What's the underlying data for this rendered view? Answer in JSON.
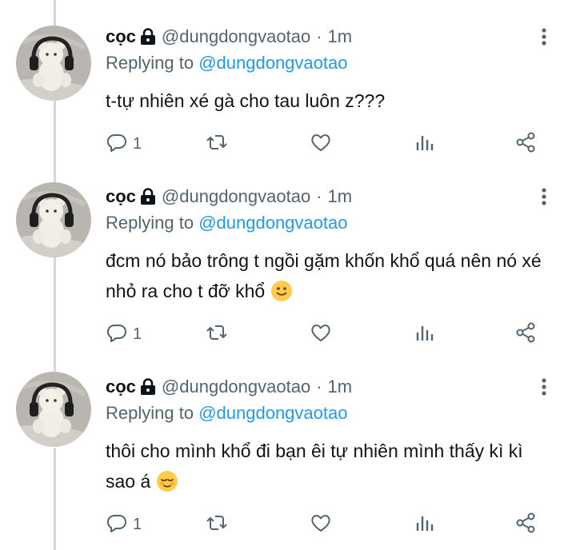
{
  "tweets": [
    {
      "name": "cọc",
      "handle": "@dungdongvaotao",
      "separator": "·",
      "time": "1m",
      "replying_label": "Replying to",
      "replying_handle": "@dungdongvaotao",
      "text": "t-tự nhiên xé gà cho tau luôn z???",
      "emoji": "",
      "reply_count": "1"
    },
    {
      "name": "cọc",
      "handle": "@dungdongvaotao",
      "separator": "·",
      "time": "1m",
      "replying_label": "Replying to",
      "replying_handle": "@dungdongvaotao",
      "text": "đcm nó bảo trông t ngồi gặm khốn khổ quá nên nó xé nhỏ ra cho t đỡ khổ",
      "emoji": "slightly-smiling-face",
      "reply_count": "1"
    },
    {
      "name": "cọc",
      "handle": "@dungdongvaotao",
      "separator": "·",
      "time": "1m",
      "replying_label": "Replying to",
      "replying_handle": "@dungdongvaotao",
      "text": "thôi cho mình khổ đi bạn êi tự nhiên mình thấy kì kì sao á",
      "emoji": "relieved-face",
      "reply_count": "1"
    }
  ],
  "icons": {
    "lock": "lock-icon",
    "more": "more-vertical-icon",
    "reply": "reply-icon",
    "retweet": "retweet-icon",
    "like": "heart-icon",
    "views": "analytics-icon",
    "share": "share-icon"
  },
  "colors": {
    "link": "#1d9bf0",
    "secondary": "#536471",
    "text": "#0f1419",
    "thread_line": "#cfd9de"
  }
}
